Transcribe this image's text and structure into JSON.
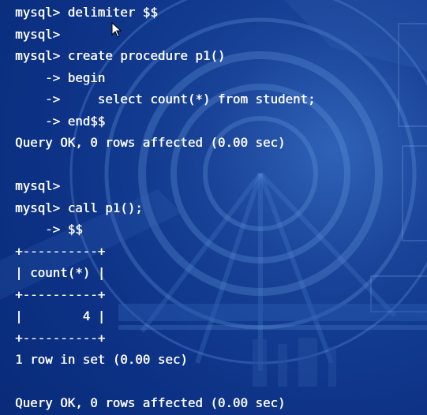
{
  "lines": [
    "mysql> delimiter $$",
    "mysql>",
    "mysql> create procedure p1()",
    "    -> begin",
    "    ->     select count(*) from student;",
    "    -> end$$",
    "Query OK, 0 rows affected (0.00 sec)",
    "",
    "mysql>",
    "mysql> call p1();",
    "    -> $$",
    "+----------+",
    "| count(*) |",
    "+----------+",
    "|        4 |",
    "+----------+",
    "1 row in set (0.00 sec)",
    "",
    "Query OK, 0 rows affected (0.00 sec)"
  ],
  "colors": {
    "text": "#ffffff",
    "background": "#0d3286"
  },
  "icons": {
    "cursor": "mouse-pointer-icon"
  }
}
